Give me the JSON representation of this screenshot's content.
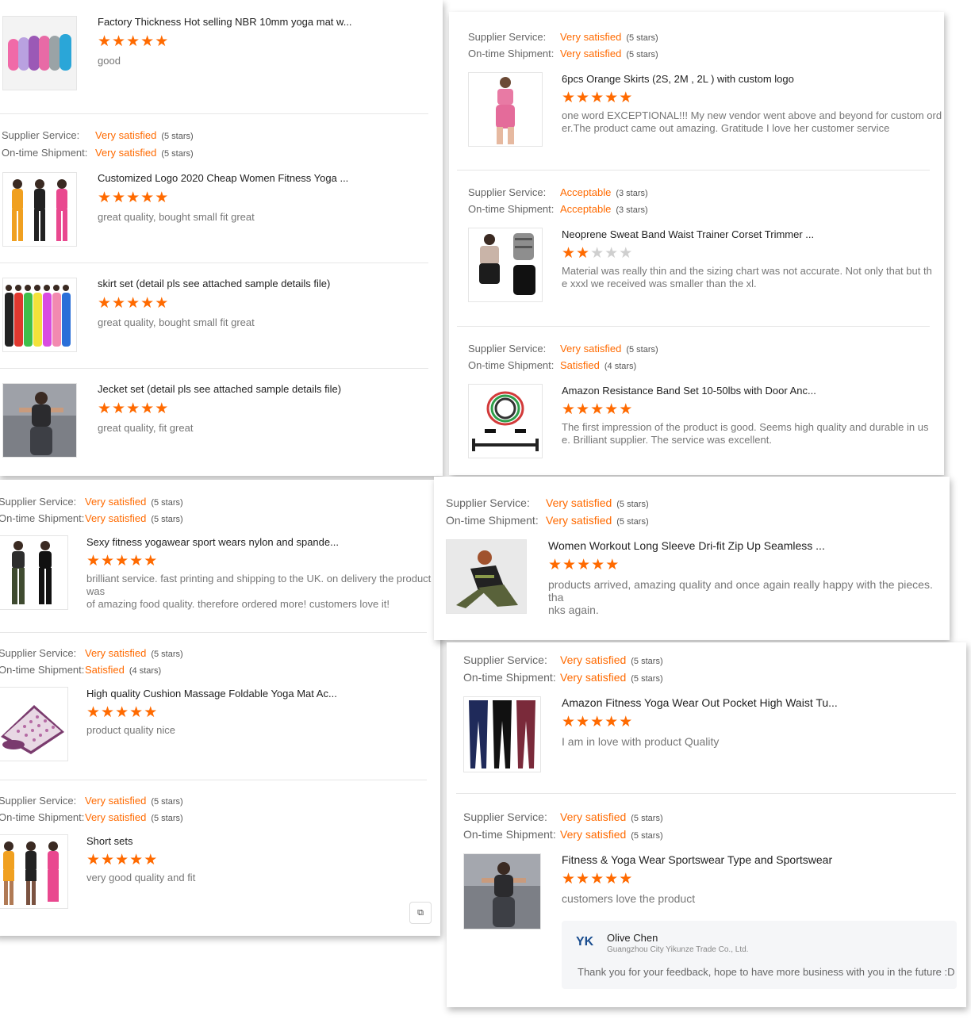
{
  "labels": {
    "supplier_service": "Supplier Service:",
    "ontime_shipment": "On-time Shipment:"
  },
  "colors": {
    "accent": "#ff6a00",
    "star_off": "#cfcfcf"
  },
  "panel1": {
    "reviews": [
      {
        "supplier_rating": "",
        "supplier_count": "",
        "shipment_rating": "",
        "shipment_count": "",
        "title": "Factory Thickness Hot selling NBR 10mm yoga mat w...",
        "stars": 5,
        "comment": "good",
        "image_icon": "yoga-mats-image"
      },
      {
        "supplier_rating": "Very satisfied",
        "supplier_count": "(5 stars)",
        "shipment_rating": "Very satisfied",
        "shipment_count": "(5 stars)",
        "title": "Customized Logo 2020 Cheap Women Fitness Yoga ...",
        "stars": 5,
        "comment": "great quality, bought small fit great",
        "image_icon": "tracksuits-image"
      },
      {
        "supplier_rating": "",
        "supplier_count": "",
        "shipment_rating": "",
        "shipment_count": "",
        "title": "skirt set (detail pls see attached sample details file)",
        "stars": 5,
        "comment": "great quality, bought small fit great",
        "image_icon": "colorful-sets-image"
      },
      {
        "supplier_rating": "",
        "supplier_count": "",
        "shipment_rating": "",
        "shipment_count": "",
        "title": "Jecket set (detail pls see attached sample details file)",
        "stars": 5,
        "comment": "great quality, fit great",
        "image_icon": "gym-woman-image"
      }
    ]
  },
  "panel2": {
    "reviews": [
      {
        "supplier_rating": "Very satisfied",
        "supplier_count": "(5 stars)",
        "shipment_rating": "Very satisfied",
        "shipment_count": "(5 stars)",
        "title": "6pcs Orange Skirts (2S, 2M , 2L ) with custom logo",
        "stars": 5,
        "comment_lines": [
          "one word EXCEPTIONAL!!! My new vendor went above and beyond for custom ord",
          "er.The product came out amazing. Gratitude I love her customer service"
        ],
        "image_icon": "pink-set-image"
      },
      {
        "supplier_rating": "Acceptable",
        "supplier_count": "(3 stars)",
        "shipment_rating": "Acceptable",
        "shipment_count": "(3 stars)",
        "title": "Neoprene Sweat Band Waist Trainer Corset Trimmer ...",
        "stars": 2,
        "comment_lines": [
          "Material was really thin and the sizing chart was not accurate. Not only that but th",
          "e xxxl we received was smaller than the xl."
        ],
        "image_icon": "waist-trainer-image"
      },
      {
        "supplier_rating": "Very satisfied",
        "supplier_count": "(5 stars)",
        "shipment_rating": "Satisfied",
        "shipment_count": "(4 stars)",
        "title": "Amazon Resistance Band Set 10-50lbs with Door Anc...",
        "stars": 5,
        "comment_lines": [
          "The first impression of the product is good. Seems high quality and durable in us",
          "e. Brilliant supplier. The service was excellent."
        ],
        "image_icon": "resistance-band-image"
      }
    ]
  },
  "panel3": {
    "reviews": [
      {
        "supplier_rating": "Very satisfied",
        "supplier_count": "(5 stars)",
        "shipment_rating": "Very satisfied",
        "shipment_count": "(5 stars)",
        "title": "Sexy fitness yogawear sport wears nylon and spande...",
        "stars": 5,
        "comment_lines": [
          "brilliant service. fast printing and shipping to the UK. on delivery the product was",
          "of amazing food quality. therefore ordered more! customers love it!"
        ],
        "image_icon": "black-sportswear-image"
      },
      {
        "supplier_rating": "Very satisfied",
        "supplier_count": "(5 stars)",
        "shipment_rating": "Satisfied",
        "shipment_count": "(4 stars)",
        "title": "High quality Cushion Massage Foldable Yoga Mat Ac...",
        "stars": 5,
        "comment_lines": [
          "product quality nice"
        ],
        "image_icon": "acupressure-mat-image"
      },
      {
        "supplier_rating": "Very satisfied",
        "supplier_count": "(5 stars)",
        "shipment_rating": "Very satisfied",
        "shipment_count": "(5 stars)",
        "title": "Short sets",
        "stars": 5,
        "comment_lines": [
          "very good quality and fit"
        ],
        "image_icon": "short-sets-image"
      }
    ],
    "corner_button_icon": "copy-icon"
  },
  "panel4": {
    "reviews": [
      {
        "supplier_rating": "Very satisfied",
        "supplier_count": "(5 stars)",
        "shipment_rating": "Very satisfied",
        "shipment_count": "(5 stars)",
        "title": "Women Workout Long Sleeve Dri-fit Zip Up Seamless ...",
        "stars": 5,
        "comment_lines": [
          "products arrived, amazing quality and once again really happy with the pieces. tha",
          "nks again."
        ],
        "image_icon": "workout-woman-image"
      }
    ]
  },
  "panel5": {
    "reviews": [
      {
        "supplier_rating": "Very satisfied",
        "supplier_count": "(5 stars)",
        "shipment_rating": "Very satisfied",
        "shipment_count": "(5 stars)",
        "title": "Amazon Fitness Yoga Wear Out Pocket High Waist Tu...",
        "stars": 5,
        "comment_lines": [
          "I am in love with product Quality"
        ],
        "image_icon": "leggings-image"
      },
      {
        "supplier_rating": "Very satisfied",
        "supplier_count": "(5 stars)",
        "shipment_rating": "Very satisfied",
        "shipment_count": "(5 stars)",
        "title": "Fitness & Yoga Wear Sportswear Type and Sportswear",
        "stars": 5,
        "comment_lines": [
          "customers love the product"
        ],
        "image_icon": "gym-woman-image"
      }
    ],
    "reply": {
      "logo_text": "YK",
      "name": "Olive Chen",
      "company": "Guangzhou City Yikunze Trade Co., Ltd.",
      "text": "Thank you for your feedback, hope to have more business with you in the future :D"
    }
  }
}
